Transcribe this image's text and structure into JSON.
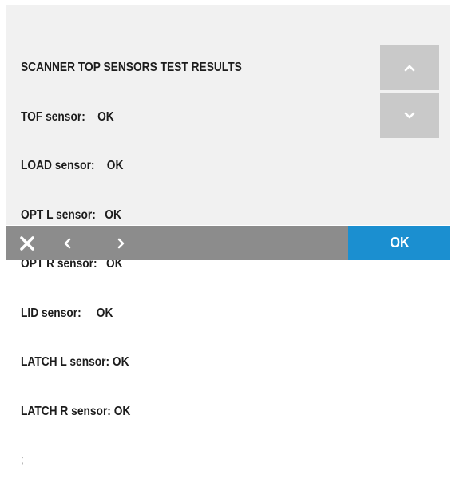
{
  "results": {
    "title": "SCANNER TOP SENSORS TEST RESULTS",
    "lines": [
      "TOF sensor:    OK",
      "LOAD sensor:    OK",
      "OPT L sensor:   OK",
      "OPT R sensor:   OK",
      "LID sensor:     OK",
      "LATCH L sensor: OK",
      "LATCH R sensor: OK"
    ],
    "trailing": ";"
  },
  "scroll": {
    "up_icon": "chevron-up-icon",
    "down_icon": "chevron-down-icon"
  },
  "bottom_bar": {
    "close_icon": "close-icon",
    "back_icon": "chevron-left-icon",
    "forward_icon": "chevron-right-icon",
    "ok_label": "OK"
  },
  "colors": {
    "panel": "#f1f1f1",
    "text": "#1c1c1c",
    "scroll_button": "#c9c9c9",
    "bottom_bar": "#8c8c8c",
    "ok_button": "#1b8fd0"
  }
}
